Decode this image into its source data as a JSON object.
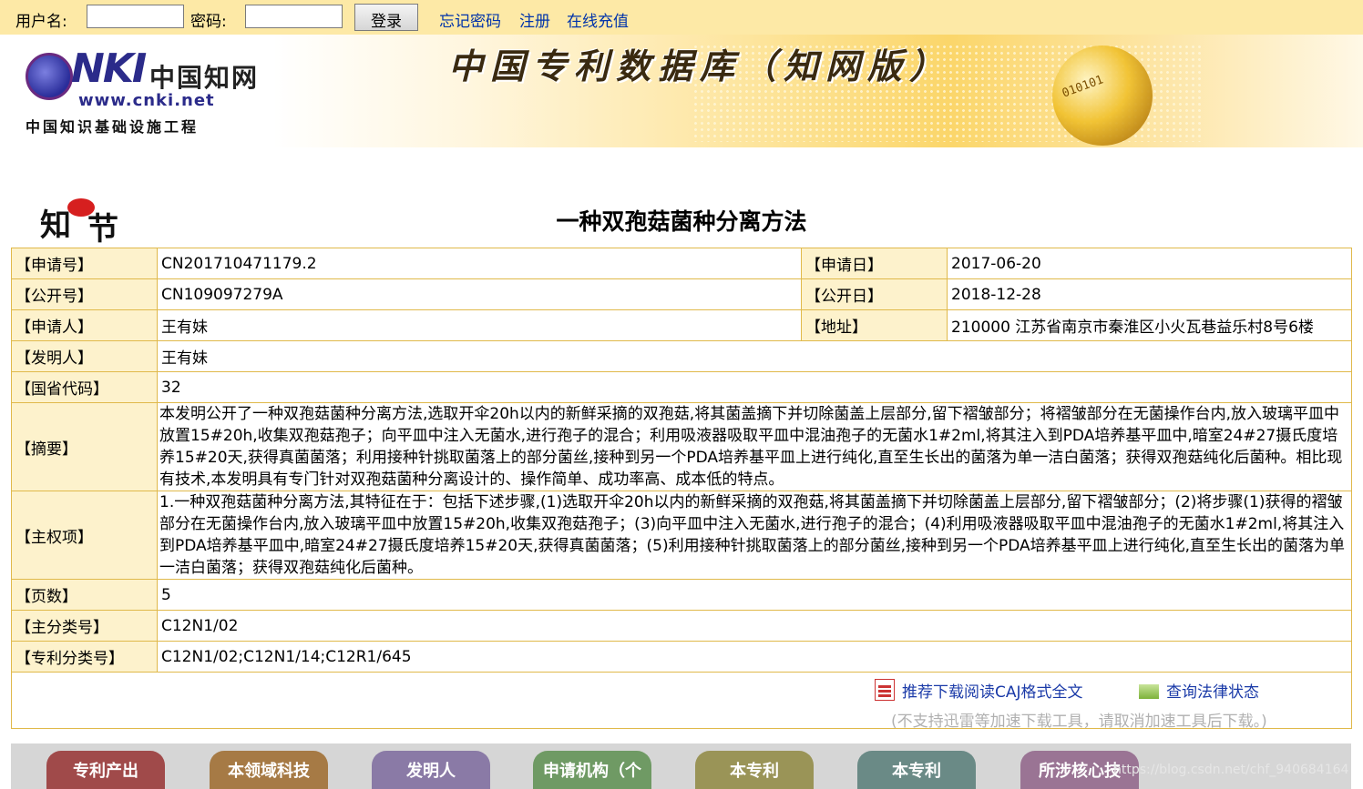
{
  "login": {
    "username_label": "用户名:",
    "username_value": "",
    "password_label": "密码:",
    "password_value": "",
    "login_button": "登录",
    "links": [
      "忘记密码",
      "注册",
      "在线充值"
    ]
  },
  "banner": {
    "logo_cn": "中国知网",
    "logo_url": "www.cnki.net",
    "logo_sub": "中国知识基础设施工程",
    "database_title": "中国专利数据库（知网版）",
    "globe_bits": "010101"
  },
  "seal": {
    "text_a": "知",
    "text_b": "节"
  },
  "doc_title": "一种双孢菇菌种分离方法",
  "fields": {
    "app_no_label": "【申请号】",
    "app_no": "CN201710471179.2",
    "app_date_label": "【申请日】",
    "app_date": "2017-06-20",
    "pub_no_label": "【公开号】",
    "pub_no": "CN109097279A",
    "pub_date_label": "【公开日】",
    "pub_date": "2018-12-28",
    "applicant_label": "【申请人】",
    "applicant": "王有妹",
    "address_label": "【地址】",
    "address": "210000 江苏省南京市秦淮区小火瓦巷益乐村8号6楼",
    "inventor_label": "【发明人】",
    "inventor": "王有妹",
    "province_code_label": "【国省代码】",
    "province_code": "32",
    "abstract_label": "【摘要】",
    "abstract": "本发明公开了一种双孢菇菌种分离方法,选取开伞20h以内的新鲜采摘的双孢菇,将其菌盖摘下并切除菌盖上层部分,留下褶皱部分；将褶皱部分在无菌操作台内,放入玻璃平皿中放置15#20h,收集双孢菇孢子；向平皿中注入无菌水,进行孢子的混合；利用吸液器吸取平皿中混油孢子的无菌水1#2ml,将其注入到PDA培养基平皿中,暗室24#27摄氏度培养15#20天,获得真菌菌落；利用接种针挑取菌落上的部分菌丝,接种到另一个PDA培养基平皿上进行纯化,直至生长出的菌落为单一洁白菌落；获得双孢菇纯化后菌种。相比现有技术,本发明具有专门针对双孢菇菌种分离设计的、操作简单、成功率高、成本低的特点。",
    "main_claim_label": "【主权项】",
    "main_claim": "1.一种双孢菇菌种分离方法,其特征在于：包括下述步骤,(1)选取开伞20h以内的新鲜采摘的双孢菇,将其菌盖摘下并切除菌盖上层部分,留下褶皱部分；(2)将步骤(1)获得的褶皱部分在无菌操作台内,放入玻璃平皿中放置15#20h,收集双孢菇孢子；(3)向平皿中注入无菌水,进行孢子的混合；(4)利用吸液器吸取平皿中混油孢子的无菌水1#2ml,将其注入到PDA培养基平皿中,暗室24#27摄氏度培养15#20天,获得真菌菌落；(5)利用接种针挑取菌落上的部分菌丝,接种到另一个PDA培养基平皿上进行纯化,直至生长出的菌落为单一洁白菌落；获得双孢菇纯化后菌种。",
    "pages_label": "【页数】",
    "pages": "5",
    "main_class_label": "【主分类号】",
    "main_class": "C12N1/02",
    "patent_class_label": "【专利分类号】",
    "patent_class": "C12N1/02;C12N1/14;C12R1/645"
  },
  "actions": {
    "download": "推荐下载阅读CAJ格式全文",
    "legal_status": "查询法律状态",
    "notice": "(不支持迅雷等加速下载工具，请取消加速工具后下载。)"
  },
  "tabs": [
    {
      "label": "专利产出",
      "color": "#a04a4a"
    },
    {
      "label": "本领域科技",
      "color": "#a67a45"
    },
    {
      "label": "发明人",
      "color": "#8a7aa6"
    },
    {
      "label": "申请机构（个",
      "color": "#6f9a64"
    },
    {
      "label": "本专利",
      "color": "#9a9457"
    },
    {
      "label": "本专利",
      "color": "#6a8a86"
    },
    {
      "label": "所涉核心技",
      "color": "#9a7494"
    }
  ],
  "watermark": "https://blog.csdn.net/chf_940684164"
}
